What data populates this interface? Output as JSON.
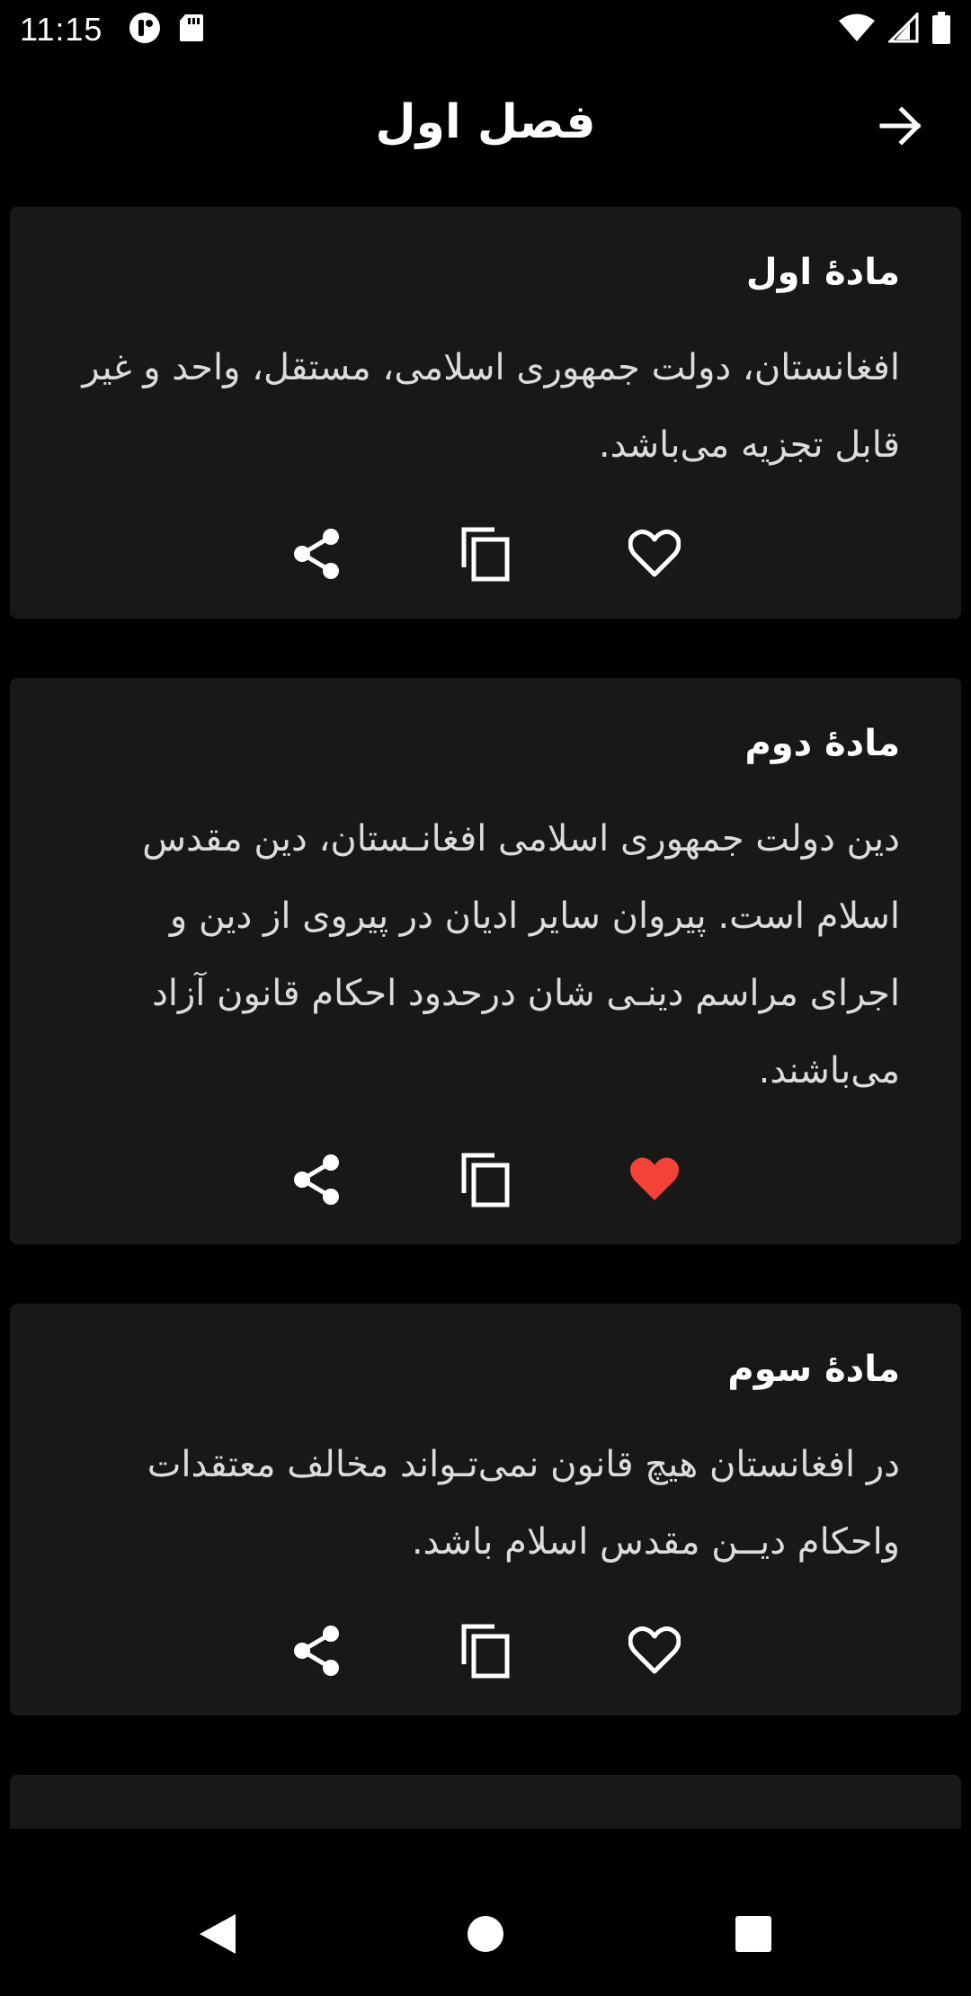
{
  "status_bar": {
    "time": "11:15"
  },
  "header": {
    "title": "فصل اول",
    "back_icon": "arrow-forward-icon"
  },
  "articles": [
    {
      "title": "مادۀ اول",
      "body": "افغانستان، دولت جمهوری اسلامی، مستقل، واحد و غیر قابل تجزیه می‌باشد.",
      "favorited": false
    },
    {
      "title": "مادۀ دوم",
      "body": "دین دولت جمهوری اسلامی افغانـستان، دین مقدس اسلام است.  پیروان سایر ادیان در پیروی از دین و اجرای مراسم دینـی شان درحدود احکام قانون آزاد می‌باشند.",
      "favorited": true
    },
    {
      "title": "مادۀ سوم",
      "body": "در افغانستان هیچ قانون نمی‌تـواند مخالف معتقدات واحکام دیــن مقدس اسلام باشد.",
      "favorited": false
    }
  ],
  "colors": {
    "background": "#000000",
    "card": "#181818",
    "favorite_active": "#f44336",
    "text_primary": "#ffffff",
    "text_body": "#dcdcdc"
  }
}
